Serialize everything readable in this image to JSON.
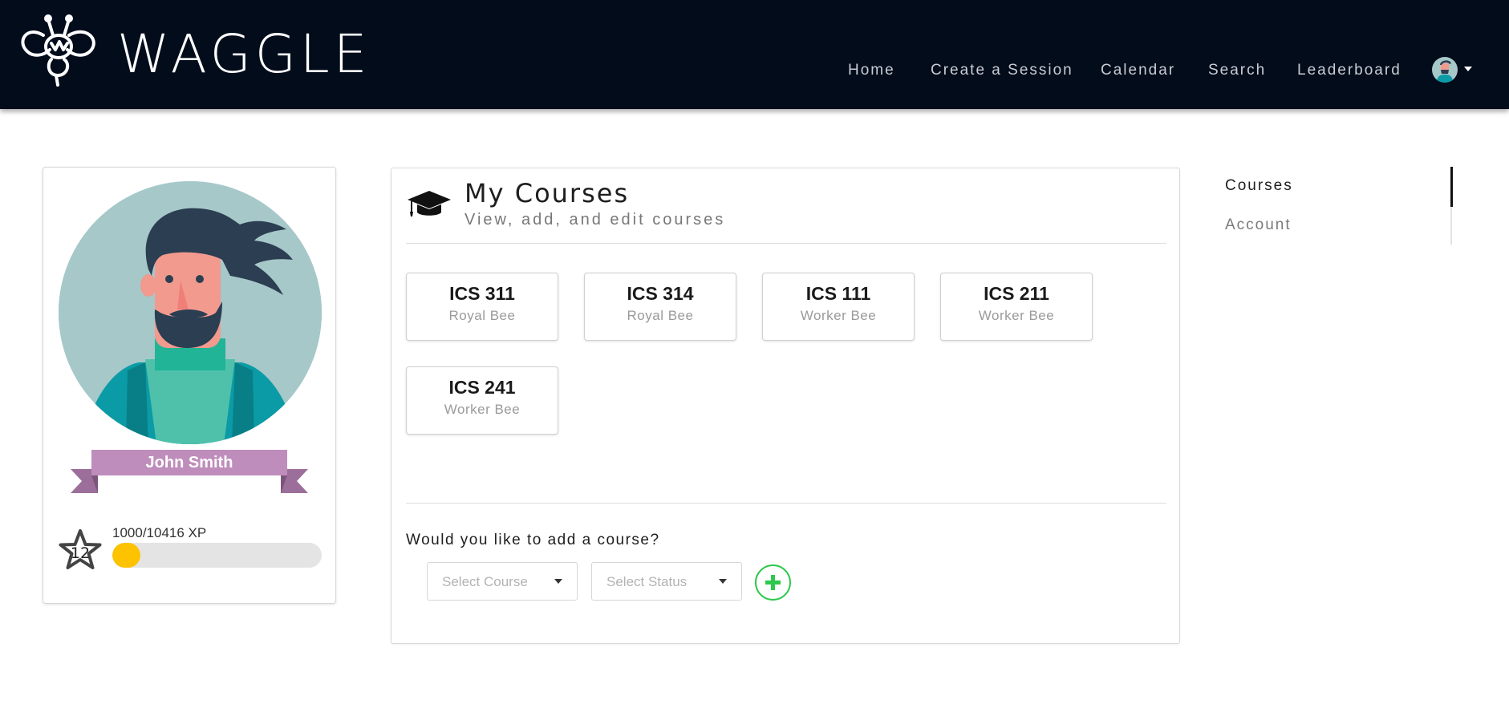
{
  "header": {
    "brand": "WAGGLE",
    "nav": [
      {
        "label": "Home"
      },
      {
        "label": "Create a Session"
      },
      {
        "label": "Calendar"
      },
      {
        "label": "Search"
      },
      {
        "label": "Leaderboard"
      }
    ],
    "user_menu_icon": "caret-down-icon"
  },
  "profile": {
    "name": "John Smith",
    "level": "12",
    "xp_text": "1000/10416 XP",
    "xp_current": 1000,
    "xp_total": 10416,
    "ribbon_color": "#bf8dbb",
    "xp_color": "#fdc200"
  },
  "main": {
    "title": "My Courses",
    "subtitle": "View, add, and edit courses",
    "courses": [
      {
        "code": "ICS 311",
        "role": "Royal Bee"
      },
      {
        "code": "ICS 314",
        "role": "Royal Bee"
      },
      {
        "code": "ICS 111",
        "role": "Worker Bee"
      },
      {
        "code": "ICS 211",
        "role": "Worker Bee"
      },
      {
        "code": "ICS 241",
        "role": "Worker Bee"
      }
    ],
    "add_prompt": "Would you like to add a course?",
    "course_select": {
      "placeholder": "Select Course"
    },
    "status_select": {
      "placeholder": "Select Status"
    },
    "add_icon": "plus-icon",
    "add_color": "#2ec84c"
  },
  "side_nav": {
    "items": [
      {
        "label": "Courses",
        "active": true
      },
      {
        "label": "Account",
        "active": false
      }
    ]
  }
}
